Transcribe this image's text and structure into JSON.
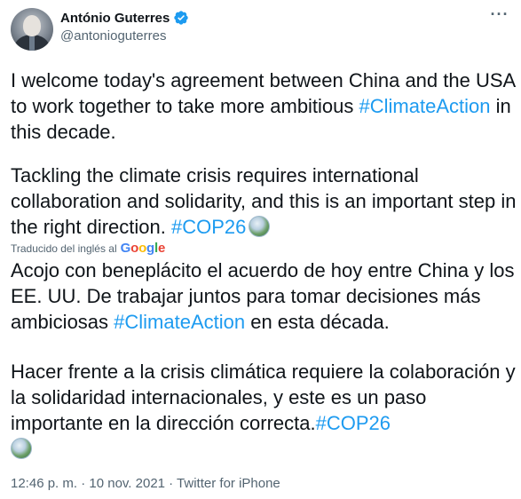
{
  "author": {
    "display_name": "António Guterres",
    "handle": "@antonioguterres"
  },
  "tweet": {
    "para1": {
      "before": "I welcome today's agreement between China and the USA to work together to take more ambitious ",
      "hashtag": "#ClimateAction",
      "after": " in this decade."
    },
    "para2": {
      "before": "Tackling the climate crisis requires international collaboration and solidarity, and this is an important step in the right direction. ",
      "hashtag": "#COP26"
    },
    "translation_label": "Traducido del inglés al",
    "translation_provider": "Google",
    "para3": {
      "before": "Acojo con beneplácito el acuerdo de hoy entre China y los EE. UU. De trabajar juntos para tomar decisiones más ambiciosas ",
      "hashtag": "#ClimateAction",
      "after": " en esta década."
    },
    "para4": {
      "before": " Hacer frente a la crisis climática requiere la colaboración y la solidaridad internacionales, y este es un paso importante en la dirección correcta.",
      "hashtag": "#COP26"
    },
    "timestamp": "12:46 p. m. · 10 nov. 2021 · Twitter for iPhone"
  },
  "icons": {
    "verified": "verified-badge-icon",
    "more": "more-options-icon",
    "emoji": "cop26-globe-emoji-icon"
  },
  "colors": {
    "accent": "#1d9bf0",
    "text": "#0f1419",
    "secondary": "#536471"
  }
}
